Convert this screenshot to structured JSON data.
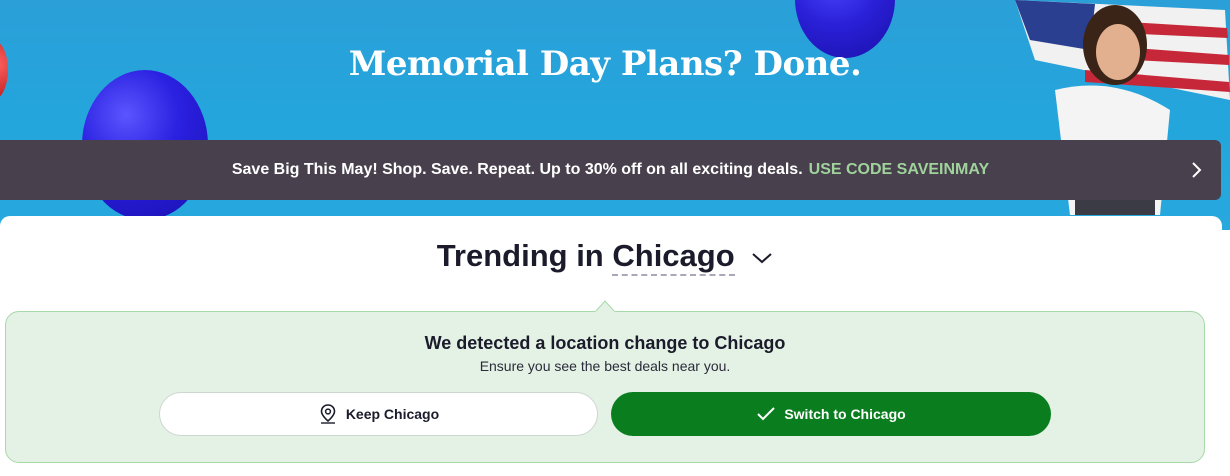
{
  "hero": {
    "title": "Memorial Day Plans? Done."
  },
  "promo": {
    "text": "Save Big This May! Shop. Save. Repeat. Up to 30% off on all exciting deals.",
    "code_text": "USE CODE SAVEINMAY",
    "code_color": "#9fd39b",
    "icon": "chevron-right-icon"
  },
  "trending": {
    "prefix": "Trending in",
    "city": "Chicago",
    "icon": "chevron-down-icon"
  },
  "location_notice": {
    "title": "We detected a location change to Chicago",
    "subtitle": "Ensure you see the best deals near you.",
    "keep_label": "Keep Chicago",
    "keep_icon": "map-pin-icon",
    "switch_label": "Switch to Chicago",
    "switch_icon": "checkmark-icon",
    "accent": "#0a7e1f"
  }
}
